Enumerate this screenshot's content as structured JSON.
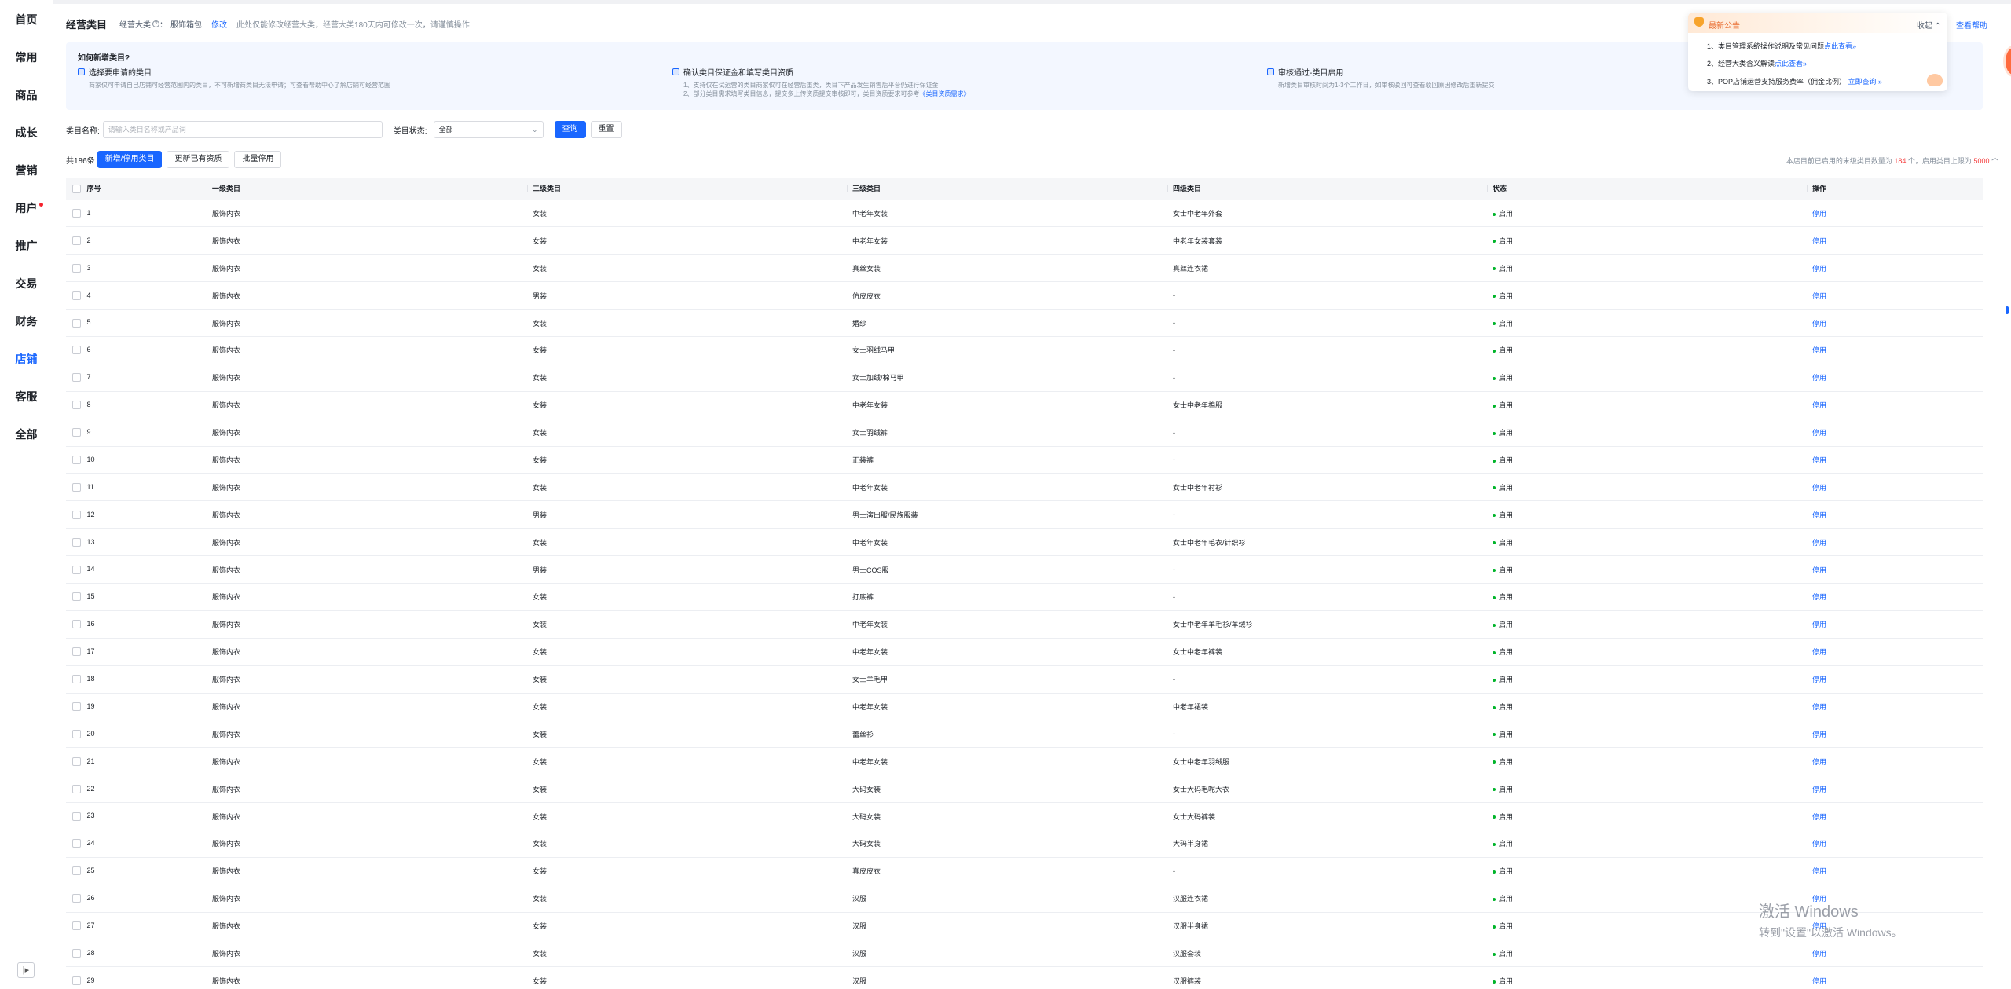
{
  "sidebar": {
    "items": [
      {
        "label": "首页"
      },
      {
        "label": "常用"
      },
      {
        "label": "商品"
      },
      {
        "label": "成长"
      },
      {
        "label": "营销"
      },
      {
        "label": "用户"
      },
      {
        "label": "推广"
      },
      {
        "label": "交易"
      },
      {
        "label": "财务"
      },
      {
        "label": "店铺"
      },
      {
        "label": "客服"
      },
      {
        "label": "全部"
      }
    ],
    "active_label": "店铺",
    "badge_on": "用户",
    "collapse_icon": "collapse-sidebar-icon",
    "collapse_glyph": "|▸"
  },
  "header": {
    "title": "经营类目",
    "main_category_label": "经营大类",
    "main_category_value": "服饰箱包",
    "modify_link": "修改",
    "note": "此处仅能修改经营大类，经营大类180天内可修改一次，请谨慎操作",
    "help_link": "查看帮助"
  },
  "guide": {
    "title": "如何新增类目?",
    "steps": [
      {
        "title": "选择要申请的类目",
        "desc": [
          "商家仅可申请自己店铺可经营范围内的类目，不可新增商类目无法申请；可查看帮助中心了解店铺可经营范围"
        ],
        "link": ""
      },
      {
        "title": "确认类目保证金和填写类目资质",
        "desc": [
          "1、支持仅在试运营的类目商家仅可在经营后重类，类目下产品发生销售后平台仍进行保证金",
          "2、部分类目需求填写类目信息，提交多上传资质提交审核即可，类目资质要求可参考"
        ],
        "link": "《类目资质需求》"
      },
      {
        "title": "审核通过-类目启用",
        "desc": [
          "新增类目审核时间为1-3个工作日，如审核驳回可查看驳回原因修改后重新提交"
        ],
        "link": ""
      }
    ]
  },
  "notice": {
    "title": "最新公告",
    "collapse_label": "收起",
    "items": [
      {
        "text": "1、类目管理系统操作说明及常见问题",
        "link": "点此查看»"
      },
      {
        "text": "2、经营大类含义解读",
        "link": "点此查看»"
      },
      {
        "text": "3、POP店铺运营支持服务费率（佣金比例）",
        "link": "立即查询 »"
      }
    ]
  },
  "filter": {
    "name_label": "类目名称:",
    "name_placeholder": "请输入类目名称或产品词",
    "status_label": "类目状态:",
    "status_value": "全部",
    "query_button": "查询",
    "reset_button": "重置"
  },
  "actions": {
    "total": "共186条",
    "add_button": "新增/停用类目",
    "update_button": "更新已有资质",
    "batch_button": "批量停用",
    "quota_prefix": "本店目前已启用的末级类目数量为",
    "quota_used": "184",
    "quota_mid": "个，启用类目上限为",
    "quota_limit": "5000",
    "quota_suffix": "个"
  },
  "table": {
    "columns": [
      "序号",
      "一级类目",
      "二级类目",
      "三级类目",
      "四级类目",
      "状态",
      "操作"
    ],
    "rows": [
      [
        "1",
        "服饰内衣",
        "女装",
        "中老年女装",
        "女士中老年外套",
        "启用",
        "停用"
      ],
      [
        "2",
        "服饰内衣",
        "女装",
        "中老年女装",
        "中老年女装套装",
        "启用",
        "停用"
      ],
      [
        "3",
        "服饰内衣",
        "女装",
        "真丝女装",
        "真丝连衣裙",
        "启用",
        "停用"
      ],
      [
        "4",
        "服饰内衣",
        "男装",
        "仿皮皮衣",
        "-",
        "启用",
        "停用"
      ],
      [
        "5",
        "服饰内衣",
        "女装",
        "婚纱",
        "-",
        "启用",
        "停用"
      ],
      [
        "6",
        "服饰内衣",
        "女装",
        "女士羽绒马甲",
        "-",
        "启用",
        "停用"
      ],
      [
        "7",
        "服饰内衣",
        "女装",
        "女士加绒/棉马甲",
        "-",
        "启用",
        "停用"
      ],
      [
        "8",
        "服饰内衣",
        "女装",
        "中老年女装",
        "女士中老年棉服",
        "启用",
        "停用"
      ],
      [
        "9",
        "服饰内衣",
        "女装",
        "女士羽绒裤",
        "-",
        "启用",
        "停用"
      ],
      [
        "10",
        "服饰内衣",
        "女装",
        "正装裤",
        "-",
        "启用",
        "停用"
      ],
      [
        "11",
        "服饰内衣",
        "女装",
        "中老年女装",
        "女士中老年衬衫",
        "启用",
        "停用"
      ],
      [
        "12",
        "服饰内衣",
        "男装",
        "男士演出服/民族服装",
        "-",
        "启用",
        "停用"
      ],
      [
        "13",
        "服饰内衣",
        "女装",
        "中老年女装",
        "女士中老年毛衣/针织衫",
        "启用",
        "停用"
      ],
      [
        "14",
        "服饰内衣",
        "男装",
        "男士COS服",
        "-",
        "启用",
        "停用"
      ],
      [
        "15",
        "服饰内衣",
        "女装",
        "打底裤",
        "-",
        "启用",
        "停用"
      ],
      [
        "16",
        "服饰内衣",
        "女装",
        "中老年女装",
        "女士中老年羊毛衫/羊绒衫",
        "启用",
        "停用"
      ],
      [
        "17",
        "服饰内衣",
        "女装",
        "中老年女装",
        "女士中老年裤装",
        "启用",
        "停用"
      ],
      [
        "18",
        "服饰内衣",
        "女装",
        "女士羊毛甲",
        "-",
        "启用",
        "停用"
      ],
      [
        "19",
        "服饰内衣",
        "女装",
        "中老年女装",
        "中老年裙装",
        "启用",
        "停用"
      ],
      [
        "20",
        "服饰内衣",
        "女装",
        "蕾丝衫",
        "-",
        "启用",
        "停用"
      ],
      [
        "21",
        "服饰内衣",
        "女装",
        "中老年女装",
        "女士中老年羽绒服",
        "启用",
        "停用"
      ],
      [
        "22",
        "服饰内衣",
        "女装",
        "大码女装",
        "女士大码毛呢大衣",
        "启用",
        "停用"
      ],
      [
        "23",
        "服饰内衣",
        "女装",
        "大码女装",
        "女士大码裤装",
        "启用",
        "停用"
      ],
      [
        "24",
        "服饰内衣",
        "女装",
        "大码女装",
        "大码半身裙",
        "启用",
        "停用"
      ],
      [
        "25",
        "服饰内衣",
        "女装",
        "真皮皮衣",
        "-",
        "启用",
        "停用"
      ],
      [
        "26",
        "服饰内衣",
        "女装",
        "汉服",
        "汉服连衣裙",
        "启用",
        "停用"
      ],
      [
        "27",
        "服饰内衣",
        "女装",
        "汉服",
        "汉服半身裙",
        "启用",
        "停用"
      ],
      [
        "28",
        "服饰内衣",
        "女装",
        "汉服",
        "汉服套装",
        "启用",
        "停用"
      ],
      [
        "29",
        "服饰内衣",
        "女装",
        "汉服",
        "汉服裤装",
        "启用",
        "停用"
      ]
    ]
  },
  "watermark": {
    "line1": "激活 Windows",
    "line2": "转到\"设置\"以激活 Windows。"
  },
  "colors": {
    "accent": "#1966ff",
    "status_green": "#00b42a",
    "highlight_red": "#f53f3f",
    "notice_orange": "#e8692b"
  }
}
